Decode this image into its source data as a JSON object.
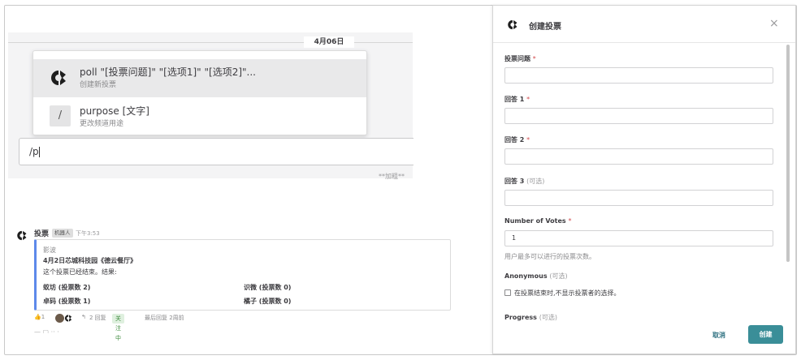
{
  "channel": {
    "date_separator": "4月06日",
    "autocomplete": [
      {
        "title": "poll \"[投票问题]\" \"[选项1]\" \"[选项2]\"...",
        "description": "创建新投票",
        "icon": "matterpoll-logo-icon"
      },
      {
        "title": "purpose [文字]",
        "description": "更改频道用途",
        "icon": "slash-icon"
      }
    ],
    "input_value": "/p",
    "format_hint": "**加粗**"
  },
  "post": {
    "username": "投票",
    "bot_tag": "机器人",
    "time": "下午3:53",
    "attachment": {
      "author": "影波",
      "title": "4月2日芯城科技园《德云餐厅》",
      "description": "这个投票已经结束。结果:",
      "fields": [
        "蚁坊 (投票数 2)",
        "识微 (投票数 0)",
        "卓码 (投票数 1)",
        "橘子 (投票数 0)"
      ]
    },
    "reaction_count": "1",
    "reply_count": "2 回复",
    "follow_label": "关注中",
    "last_reply": "最后回复 2周前"
  },
  "dialog": {
    "title": "创建投票",
    "close_glyph": "×",
    "fields": {
      "question_label": "投票问题",
      "answer1_label": "回答 1",
      "answer2_label": "回答 2",
      "answer3_label": "回答 3",
      "votes_label": "Number of Votes",
      "votes_value": "1",
      "votes_help": "用户最多可以进行的投票次数。",
      "anonymous_label": "Anonymous",
      "anonymous_checkbox": "在投票结束时,不显示投票者的选择。",
      "progress_label": "Progress"
    },
    "required_mark": "*",
    "optional_mark": "(可选)",
    "cancel_label": "取消",
    "create_label": "创建"
  },
  "colors": {
    "accent": "#3a8e98",
    "attachment_border": "#5d89ea",
    "required": "#d24b4e",
    "follow_bg": "#dff0df"
  }
}
